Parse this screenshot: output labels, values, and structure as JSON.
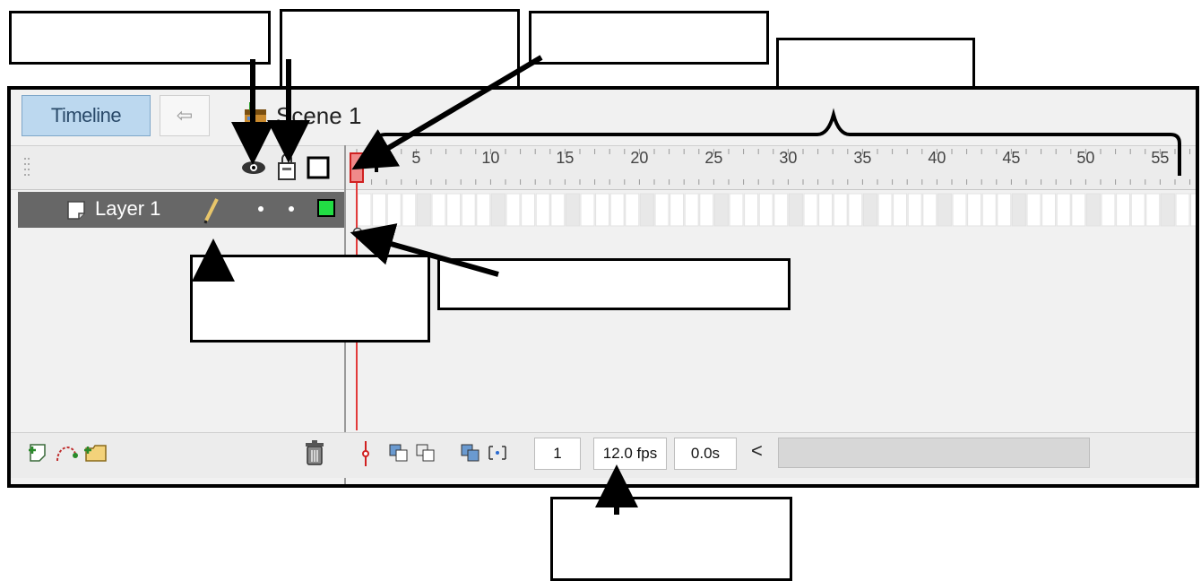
{
  "timeline_tab": "Timeline",
  "back_glyph": "⇦",
  "scene_name": "Scene 1",
  "layer_name": "Layer 1",
  "ruler_numbers": [
    "5",
    "10",
    "15",
    "20",
    "25",
    "30",
    "35",
    "40",
    "45",
    "50",
    "55"
  ],
  "status": {
    "current_frame": "1",
    "frame_rate": "12.0 fps",
    "elapsed_time": "0.0s",
    "scroll_left": "<"
  },
  "colors": {
    "tab_bg": "#bcd8ef",
    "layer_bg": "#676767",
    "playhead": "#e23b3b",
    "outline_swatch": "#22dd44"
  },
  "icons": [
    "eye-icon",
    "lock-icon",
    "outline-icon",
    "pencil-icon",
    "new-layer-icon",
    "motion-guide-icon",
    "new-folder-icon",
    "trash-icon",
    "center-frame-icon",
    "onion-skin-icon",
    "onion-outline-icon",
    "edit-multiple-icon",
    "onion-markers-icon"
  ]
}
